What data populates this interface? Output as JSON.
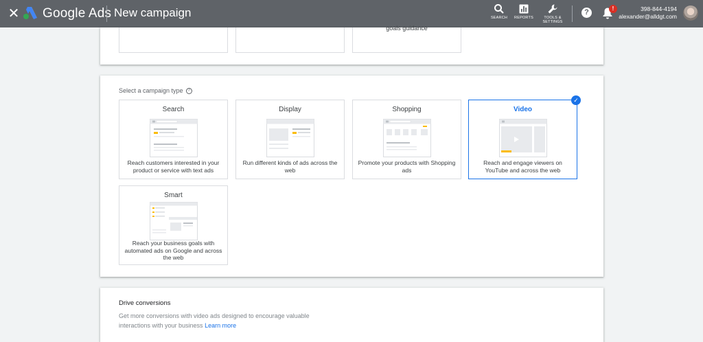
{
  "header": {
    "brand": "Google Ads",
    "title": "New campaign",
    "tools": [
      {
        "label": "SEARCH",
        "icon": "search-icon"
      },
      {
        "label": "REPORTS",
        "icon": "reports-icon"
      },
      {
        "label": "TOOLS &\nSETTINGS",
        "icon": "wrench-icon"
      }
    ],
    "notification_count": "!",
    "account_phone": "398-844-4194",
    "account_email": "alexander@alldgt.com"
  },
  "top_panel": {
    "partial_card_text": "goals guidance"
  },
  "campaign_type": {
    "label": "Select a campaign type",
    "cards": [
      {
        "name": "Search",
        "description": "Reach customers interested in your product or service with text ads"
      },
      {
        "name": "Display",
        "description": "Run different kinds of ads across the web"
      },
      {
        "name": "Shopping",
        "description": "Promote your products with Shopping ads"
      },
      {
        "name": "Video",
        "description": "Reach and engage viewers on YouTube and across the web",
        "selected": true
      },
      {
        "name": "Smart",
        "description": "Reach your business goals with automated ads on Google and across the web"
      }
    ]
  },
  "drive_conversions": {
    "title": "Drive conversions",
    "text": "Get more conversions with video ads designed to encourage valuable interactions with your business",
    "link": "Learn more"
  },
  "colors": {
    "topbar": "#5f6368",
    "accent": "#1a73e8",
    "badge": "#d93025"
  }
}
